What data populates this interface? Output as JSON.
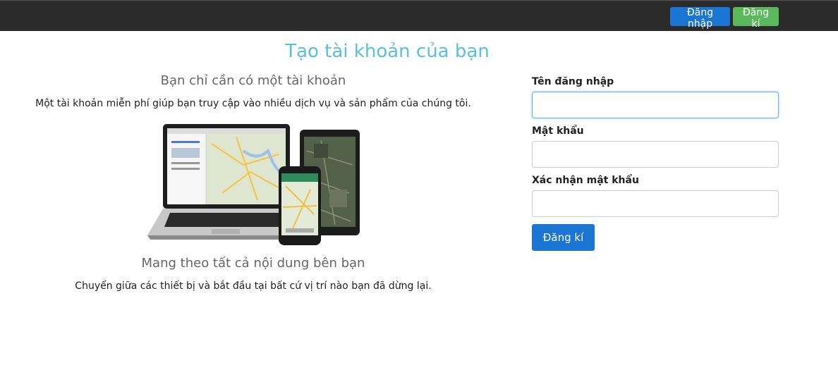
{
  "navbar": {
    "login_label": "Đăng nhập",
    "register_label": "Đăng kí"
  },
  "page": {
    "title": "Tạo tài khoản của bạn"
  },
  "intro": {
    "heading_1": "Bạn chỉ cần có một tài khoản",
    "text_1": "Một tài khoản miễn phí giúp bạn truy cập vào nhiều dịch vụ và sản phẩm của chúng tôi.",
    "heading_2": "Mang theo tất cả nội dung bên bạn",
    "text_2": "Chuyển giữa các thiết bị và bắt đầu tại bất cứ vị trí nào bạn đã dừng lại."
  },
  "form": {
    "username_label": "Tên đăng nhập",
    "username_value": "",
    "password_label": "Mật khẩu",
    "password_value": "",
    "confirm_label": "Xác nhận mật khẩu",
    "confirm_value": "",
    "submit_label": "Đăng kí"
  },
  "colors": {
    "navbar_bg": "#2b2b2b",
    "primary": "#1b76d3",
    "success": "#5cb85c",
    "title": "#5bc0de"
  },
  "icons": [
    "devices-illustration"
  ]
}
